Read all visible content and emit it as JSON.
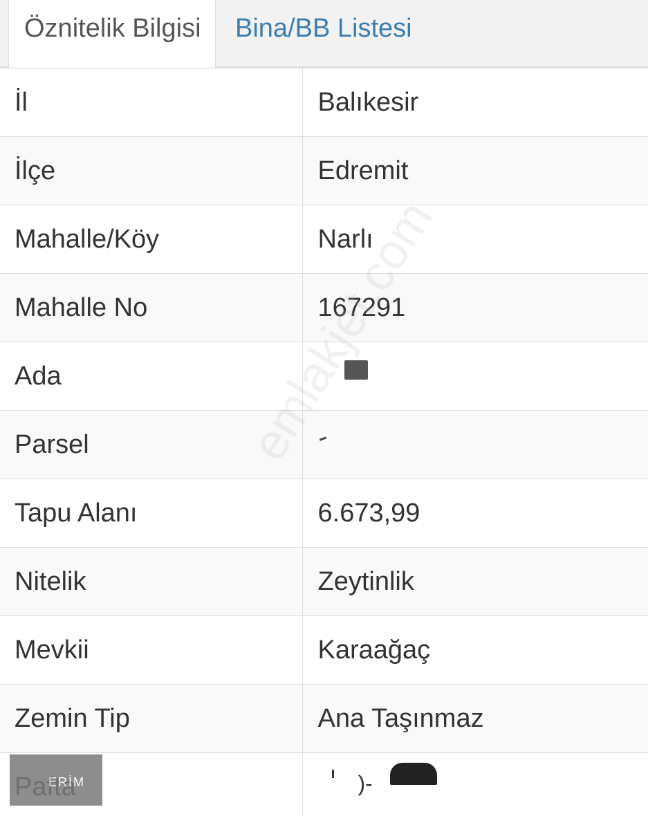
{
  "tabs": [
    {
      "label": "Öznitelik Bilgisi",
      "active": true
    },
    {
      "label": "Bina/BB Listesi",
      "active": false
    }
  ],
  "rows": [
    {
      "label": "İl",
      "value": "Balıkesir"
    },
    {
      "label": "İlçe",
      "value": "Edremit"
    },
    {
      "label": "Mahalle/Köy",
      "value": "Narlı"
    },
    {
      "label": "Mahalle No",
      "value": "167291"
    },
    {
      "label": "Ada",
      "value": ""
    },
    {
      "label": "Parsel",
      "value": ""
    },
    {
      "label": "Tapu Alanı",
      "value": "6.673,99"
    },
    {
      "label": "Nitelik",
      "value": "Zeytinlik"
    },
    {
      "label": "Mevkii",
      "value": "Karaağaç"
    },
    {
      "label": "Zemin Tip",
      "value": "Ana Taşınmaz"
    },
    {
      "label": "Pafta",
      "value": ""
    }
  ],
  "watermark": {
    "logo_text": "ERİM",
    "site_text": "emlakjet.com"
  },
  "colors": {
    "active_tab_text": "#555555",
    "inactive_tab_text": "#3a7eb0",
    "border": "#dddddd",
    "row_alt": "#f9f9f9"
  }
}
